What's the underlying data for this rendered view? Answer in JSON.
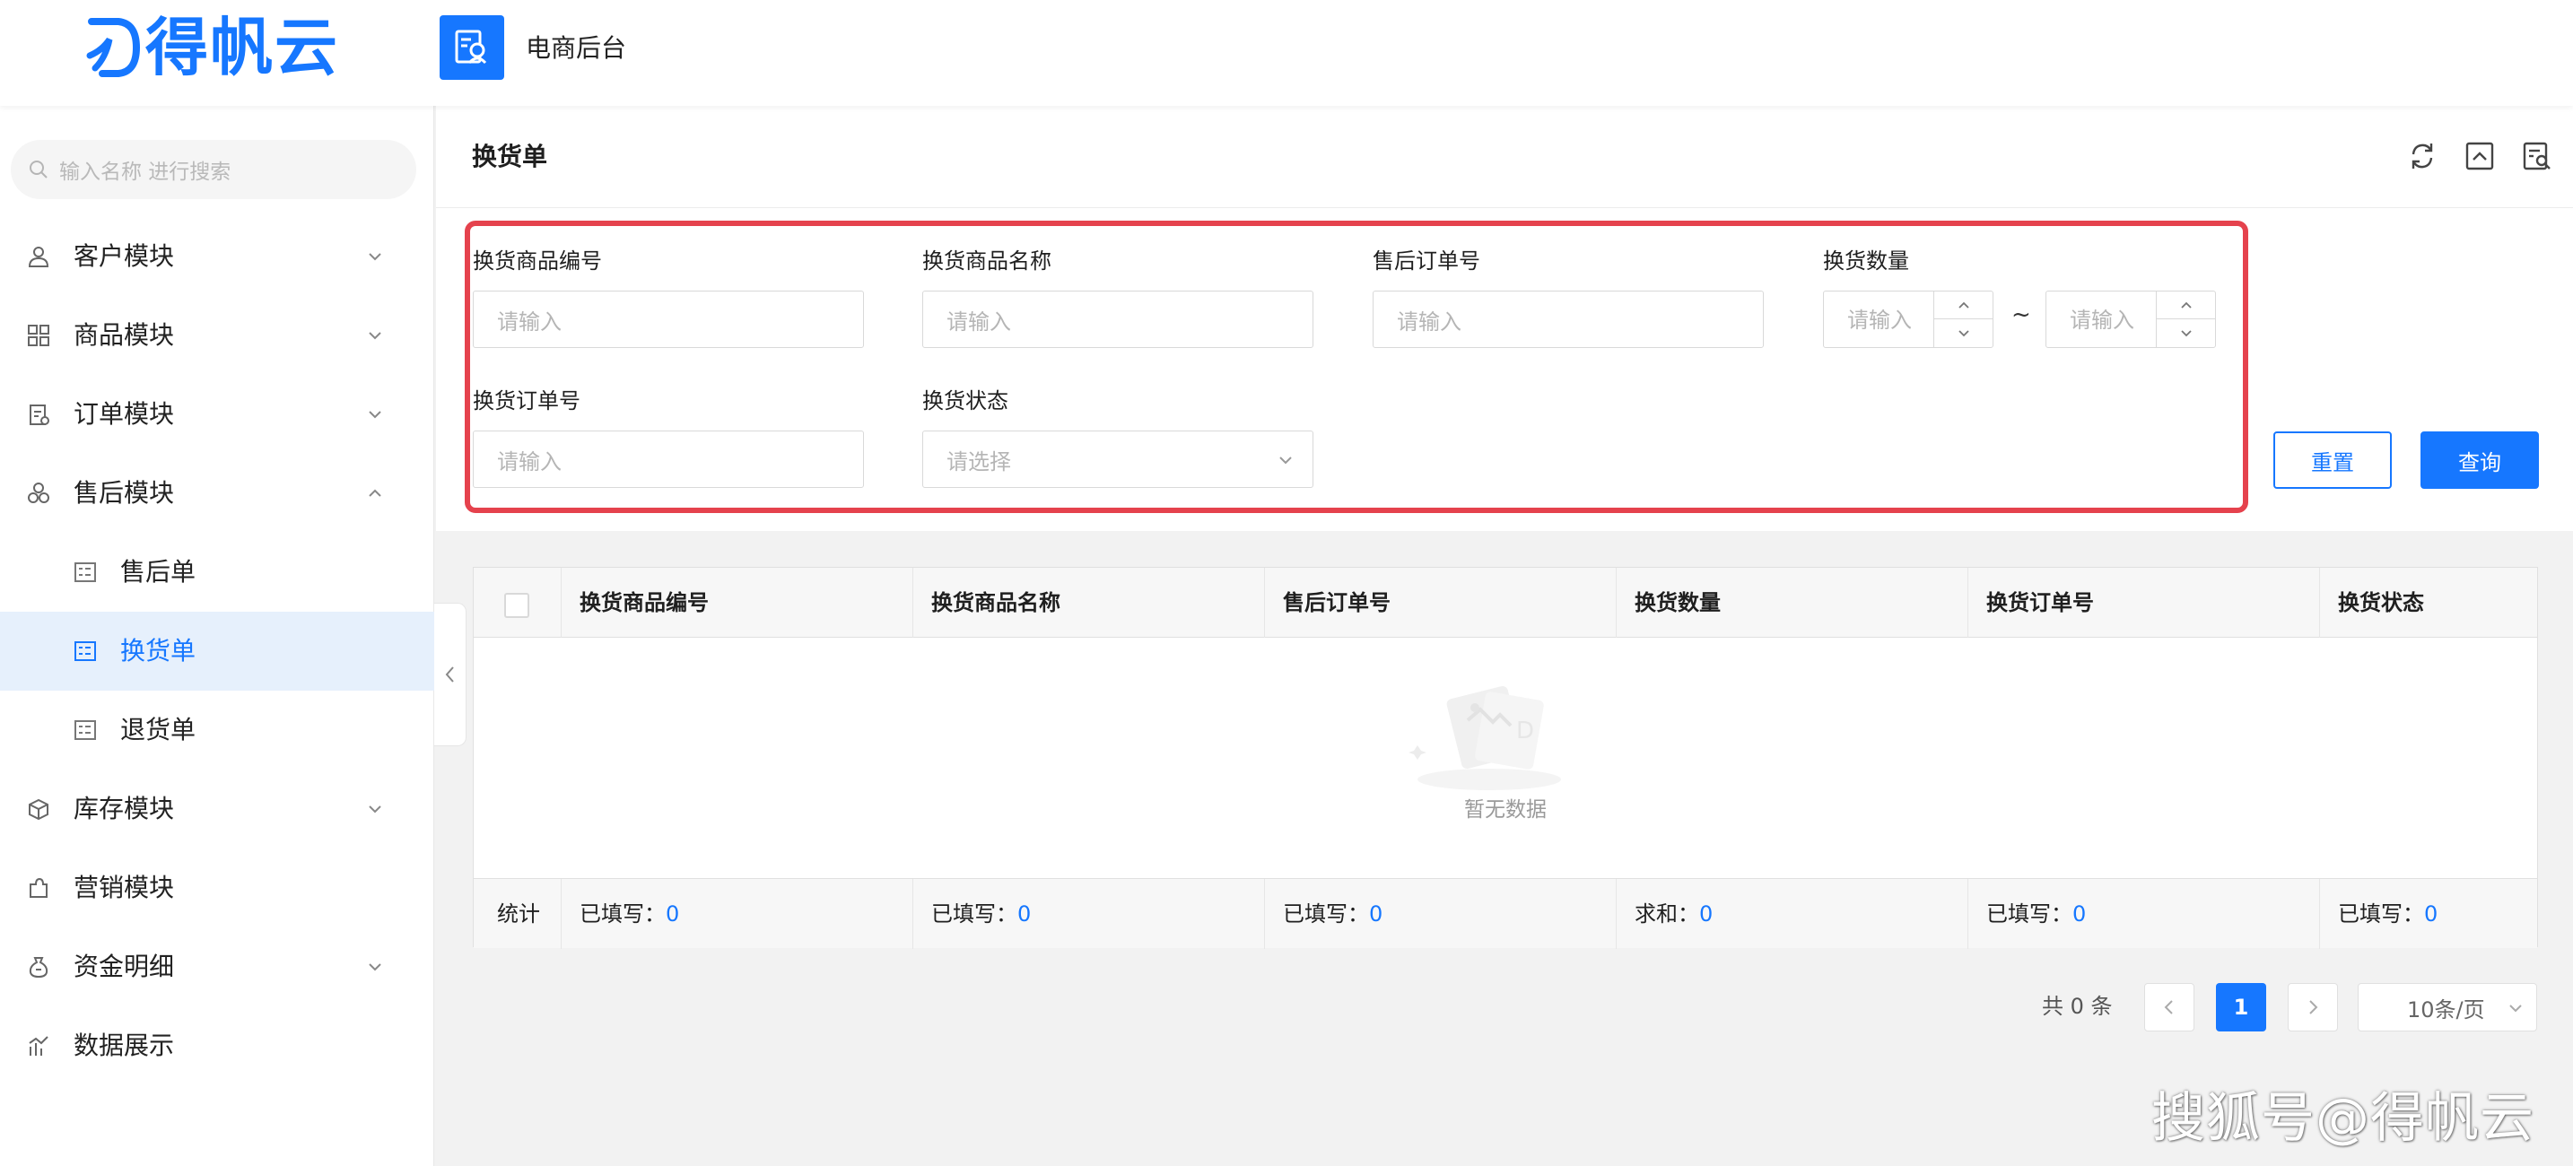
{
  "brand": {
    "name": "得帆云"
  },
  "app": {
    "title": "电商后台"
  },
  "sidebar": {
    "search_placeholder": "输入名称 进行搜索",
    "items": [
      {
        "label": "客户模块",
        "icon": "user-icon",
        "expandable": true,
        "expanded": false
      },
      {
        "label": "商品模块",
        "icon": "grid-icon",
        "expandable": true,
        "expanded": false
      },
      {
        "label": "订单模块",
        "icon": "order-doc-icon",
        "expandable": true,
        "expanded": false
      },
      {
        "label": "售后模块",
        "icon": "cubes-icon",
        "expandable": true,
        "expanded": true,
        "children": [
          {
            "label": "售后单",
            "icon": "form-icon",
            "active": false
          },
          {
            "label": "换货单",
            "icon": "form-icon",
            "active": true
          },
          {
            "label": "退货单",
            "icon": "form-icon",
            "active": false
          }
        ]
      },
      {
        "label": "库存模块",
        "icon": "box-icon",
        "expandable": true,
        "expanded": false
      },
      {
        "label": "营销模块",
        "icon": "puzzle-icon",
        "expandable": false
      },
      {
        "label": "资金明细",
        "icon": "money-bag-icon",
        "expandable": true,
        "expanded": false
      },
      {
        "label": "数据展示",
        "icon": "chart-icon",
        "expandable": false
      }
    ]
  },
  "page": {
    "title": "换货单",
    "header_icons": [
      "refresh-icon",
      "collapse-icon",
      "search-settings-icon"
    ]
  },
  "filters": {
    "product_code": {
      "label": "换货商品编号",
      "placeholder": "请输入"
    },
    "product_name": {
      "label": "换货商品名称",
      "placeholder": "请输入"
    },
    "after_sale_order": {
      "label": "售后订单号",
      "placeholder": "请输入"
    },
    "quantity": {
      "label": "换货数量",
      "min_placeholder": "请输入",
      "max_placeholder": "请输入",
      "separator": "~"
    },
    "exchange_order": {
      "label": "换货订单号",
      "placeholder": "请输入"
    },
    "status": {
      "label": "换货状态",
      "placeholder": "请选择"
    },
    "reset_label": "重置",
    "query_label": "查询",
    "highlight_color": "#e5424d"
  },
  "table": {
    "columns": [
      "换货商品编号",
      "换货商品名称",
      "售后订单号",
      "换货数量",
      "换货订单号",
      "换货状态"
    ],
    "empty_text": "暂无数据",
    "footer": {
      "label": "统计",
      "cells": [
        {
          "prefix": "已填写：",
          "value": "0"
        },
        {
          "prefix": "已填写：",
          "value": "0"
        },
        {
          "prefix": "已填写：",
          "value": "0"
        },
        {
          "prefix": "求和：",
          "value": "0"
        },
        {
          "prefix": "已填写：",
          "value": "0"
        },
        {
          "prefix": "已填写：",
          "value": "0"
        }
      ]
    }
  },
  "pagination": {
    "total": "共 0 条",
    "current_page": "1",
    "page_size": "10条/页"
  },
  "watermark": "搜狐号@得帆云",
  "colors": {
    "accent": "#1677ff",
    "active_bg": "#e6f0fc",
    "highlight": "#e5424d"
  }
}
